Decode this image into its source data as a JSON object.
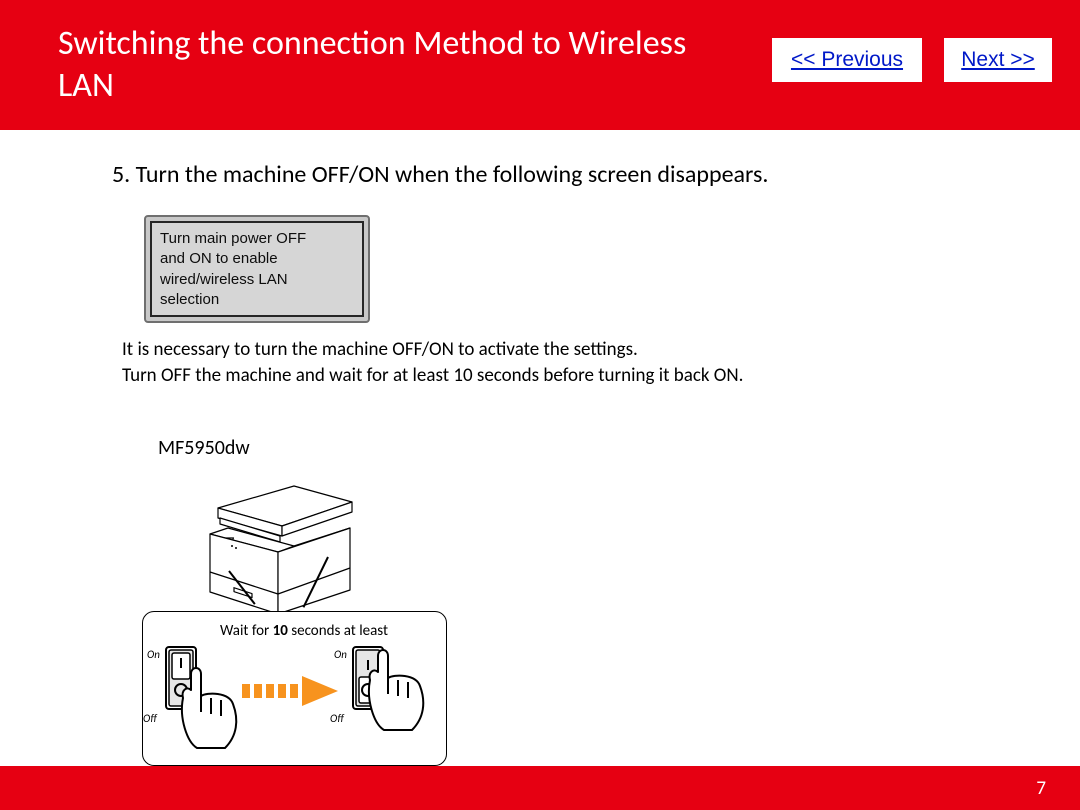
{
  "header": {
    "title": "Switching the connection Method to Wireless LAN",
    "prev_label": "<< Previous",
    "next_label": "Next >>"
  },
  "step": {
    "heading": "5. Turn the machine OFF/ON when the following screen disappears."
  },
  "lcd": {
    "text": "Turn main power OFF\nand ON to enable\nwired/wireless LAN\nselection"
  },
  "note": {
    "line1": "It is necessary to turn the machine OFF/ON to activate the settings.",
    "line2": "Turn OFF the machine and wait for at least 10 seconds before turning it back ON."
  },
  "model": "MF5950dw",
  "diagram": {
    "wait_pre": "Wait for ",
    "wait_bold": "10",
    "wait_post": " seconds at least",
    "on_label": "On",
    "off_label": "Off"
  },
  "page_number": "7",
  "colors": {
    "accent": "#e60012",
    "link": "#0018c8",
    "arrow": "#f7931e"
  }
}
